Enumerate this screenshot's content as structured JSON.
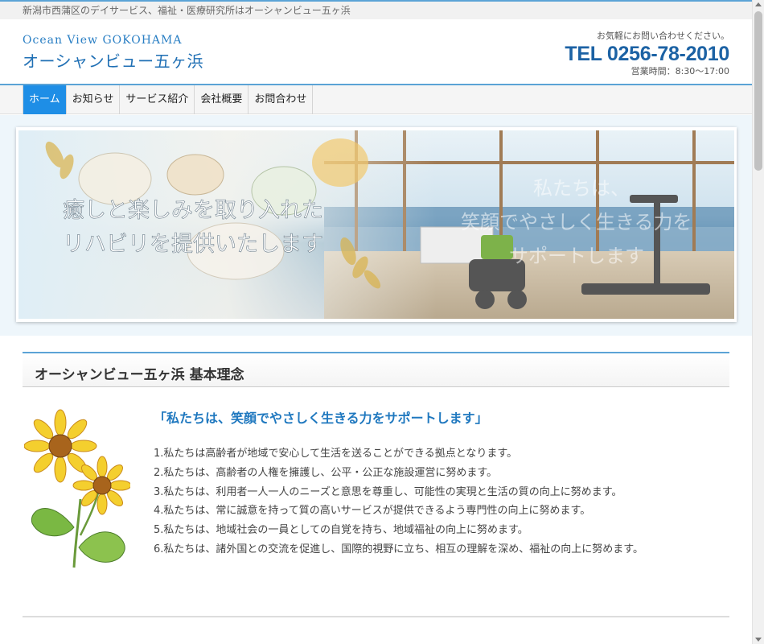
{
  "header": {
    "tagline": "新潟市西蒲区のデイサービス、福祉・医療研究所はオーシャンビュー五ヶ浜",
    "logo_en": "Ocean View GOKOHAMA",
    "logo_ja": "オーシャンビュー五ヶ浜",
    "contact_note": "お気軽にお問い合わせください。",
    "tel": "TEL 0256-78-2010",
    "hours": "営業時間：8:30〜17:00"
  },
  "nav": {
    "items": [
      {
        "label": "ホーム",
        "active": true
      },
      {
        "label": "お知らせ",
        "active": false
      },
      {
        "label": "サービス紹介",
        "active": false
      },
      {
        "label": "会社概要",
        "active": false
      },
      {
        "label": "お問合わせ",
        "active": false
      }
    ]
  },
  "hero": {
    "text_left_1": "癒しと楽しみを取り入れた",
    "text_left_2": "リハビリを提供いたします",
    "text_right_1": "私たちは、",
    "text_right_2": "笑顔でやさしく生きる力を",
    "text_right_3": "サポートします"
  },
  "main": {
    "section_title": "オーシャンビュー五ヶ浜 基本理念",
    "motto": "「私たちは、笑顔でやさしく生きる力をサポートします」",
    "principles": [
      "1.私たちは高齢者が地域で安心して生活を送ることができる拠点となります。",
      "2.私たちは、高齢者の人権を擁護し、公平・公正な施設運営に努めます。",
      "3.私たちは、利用者一人一人のニーズと意思を尊重し、可能性の実現と生活の質の向上に努めます。",
      "4.私たちは、常に誠意を持って質の高いサービスが提供できるよう専門性の向上に努めます。",
      "5.私たちは、地域社会の一員としての自覚を持ち、地域福祉の向上に努めます。",
      "6.私たちは、諸外国との交流を促進し、国際的視野に立ち、相互の理解を深め、福祉の向上に努めます。"
    ]
  },
  "colors": {
    "accent": "#1e8ee6",
    "brand_blue": "#1c62a4",
    "motto_blue": "#1f78bf"
  }
}
